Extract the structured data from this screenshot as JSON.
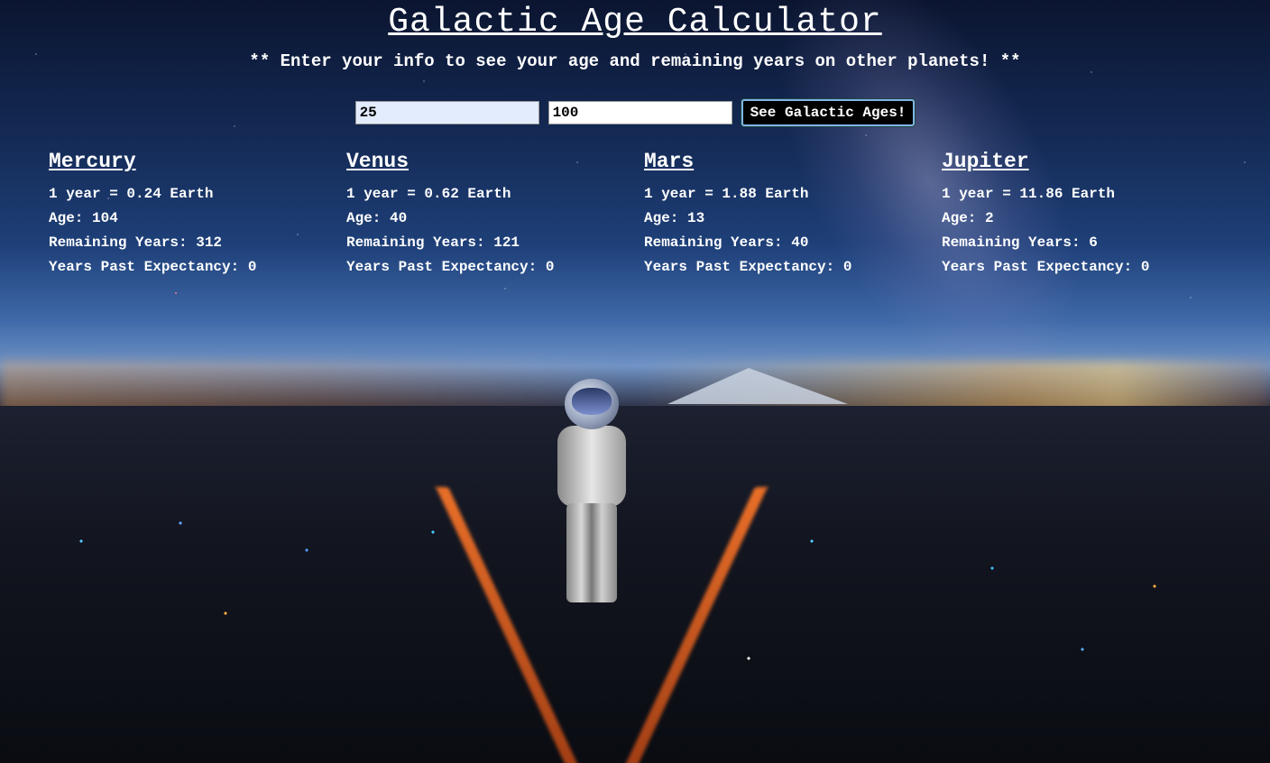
{
  "page": {
    "title": "Galactic Age Calculator",
    "subtitle": "** Enter your info to see your age and remaining years on other planets! **"
  },
  "form": {
    "age_value": "25",
    "expectancy_value": "100",
    "submit_label": "See Galactic Ages!"
  },
  "labels": {
    "age": "Age:",
    "remaining": "Remaining Years:",
    "past": "Years Past Expectancy:"
  },
  "planets": [
    {
      "name": "Mercury",
      "ratio": "1 year = 0.24 Earth",
      "age": "Age: 104",
      "remaining": "Remaining Years: 312",
      "past": "Years Past Expectancy: 0"
    },
    {
      "name": "Venus",
      "ratio": "1 year = 0.62 Earth",
      "age": "Age: 40",
      "remaining": "Remaining Years: 121",
      "past": "Years Past Expectancy: 0"
    },
    {
      "name": "Mars",
      "ratio": "1 year = 1.88 Earth",
      "age": "Age: 13",
      "remaining": "Remaining Years: 40",
      "past": "Years Past Expectancy: 0"
    },
    {
      "name": "Jupiter",
      "ratio": "1 year = 11.86 Earth",
      "age": "Age: 2",
      "remaining": "Remaining Years: 6",
      "past": "Years Past Expectancy: 0"
    }
  ],
  "colors": {
    "text": "#ffffff",
    "button_bg": "#000000",
    "button_border": "#7fb6e6",
    "age_input_bg": "#e3ecfc"
  }
}
